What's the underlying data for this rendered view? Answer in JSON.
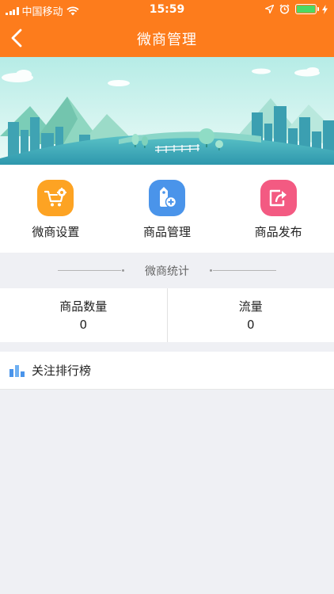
{
  "status": {
    "carrier": "中国移动",
    "time": "15:59"
  },
  "nav": {
    "title": "微商管理"
  },
  "menu": {
    "items": [
      {
        "label": "微商设置",
        "icon": "cart-gear-icon",
        "color": "#fda323"
      },
      {
        "label": "商品管理",
        "icon": "tag-add-icon",
        "color": "#4a94ea"
      },
      {
        "label": "商品发布",
        "icon": "publish-icon",
        "color": "#f35a82"
      }
    ]
  },
  "stats": {
    "title": "微商统计",
    "items": [
      {
        "label": "商品数量",
        "value": "0"
      },
      {
        "label": "流量",
        "value": "0"
      }
    ]
  },
  "ranking": {
    "label": "关注排行榜"
  },
  "colors": {
    "accent": "#fd7c1c",
    "background": "#eff0f4"
  }
}
